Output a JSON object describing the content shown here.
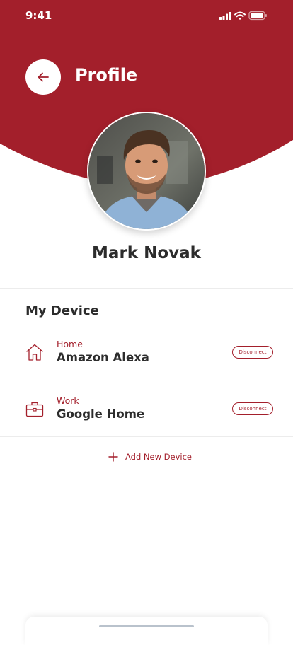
{
  "status_bar": {
    "time": "9:41"
  },
  "header": {
    "title": "Profile",
    "back_icon": "arrow-left-icon"
  },
  "profile": {
    "name": "Mark Novak"
  },
  "devices": {
    "section_title": "My Device",
    "items": [
      {
        "category": "Home",
        "name": "Amazon Alexa",
        "icon": "home-icon",
        "action_label": "Disconnect"
      },
      {
        "category": "Work",
        "name": "Google Home",
        "icon": "briefcase-icon",
        "action_label": "Disconnect"
      }
    ],
    "add_label": "Add New Device"
  },
  "colors": {
    "brand": "#a31f2b",
    "text": "#2c2c2c",
    "background": "#ffffff"
  }
}
